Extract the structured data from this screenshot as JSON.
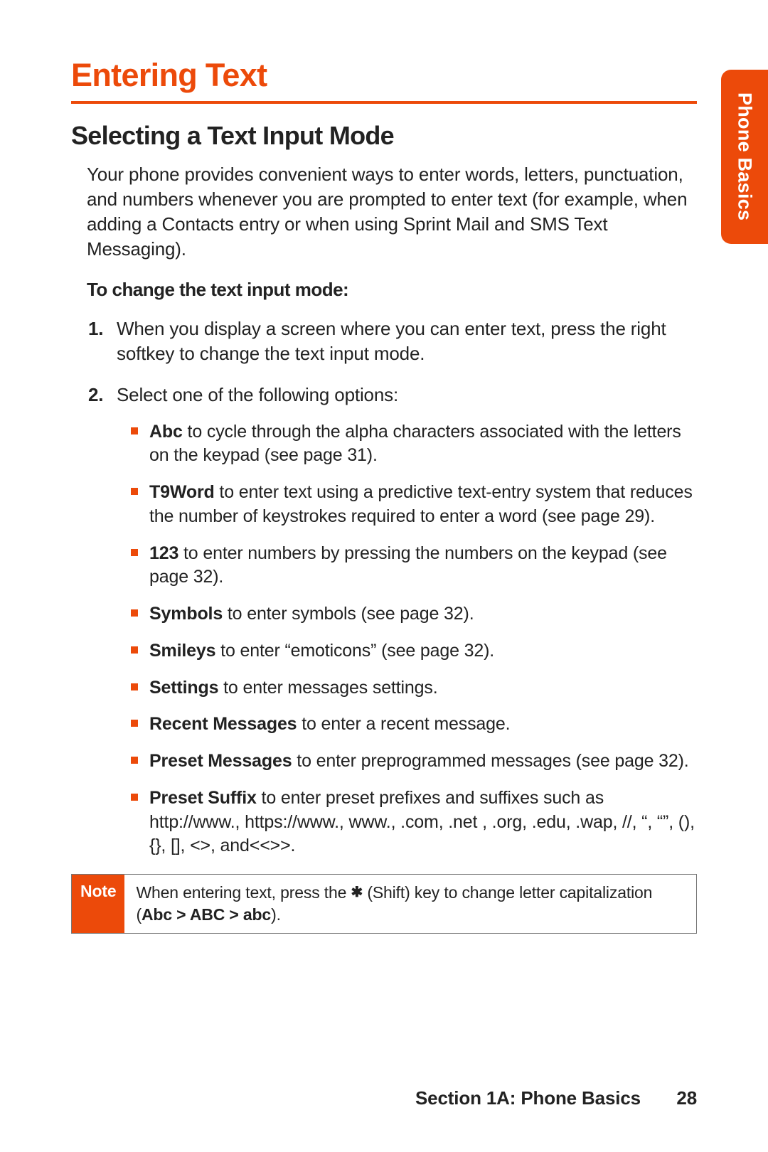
{
  "side_tab": "Phone Basics",
  "title": "Entering Text",
  "subtitle": "Selecting a Text Input Mode",
  "intro": "Your phone provides convenient ways to enter words, letters, punctuation, and numbers whenever you are prompted to enter text (for example, when adding a Contacts entry or when using Sprint Mail and SMS Text Messaging).",
  "subheading": "To change the text input mode:",
  "steps": [
    {
      "num": "1.",
      "text": "When you display a screen where you can enter text, press the right softkey to change the text input mode."
    },
    {
      "num": "2.",
      "text": "Select one of the following options:"
    }
  ],
  "options": [
    {
      "lead": "Abc",
      "rest": " to cycle through the alpha characters associated with the letters on the keypad (see page 31)."
    },
    {
      "lead": "T9Word",
      "rest": " to enter text using a predictive text-entry system that reduces the number of keystrokes required to enter a word (see page 29)."
    },
    {
      "lead": "123",
      "rest": " to enter numbers by pressing the numbers on the keypad (see page 32)."
    },
    {
      "lead": "Symbols",
      "rest": " to enter symbols (see page 32)."
    },
    {
      "lead": "Smileys",
      "rest": " to enter “emoticons” (see page 32)."
    },
    {
      "lead": "Settings",
      "rest": " to enter messages settings."
    },
    {
      "lead": "Recent Messages",
      "rest": "  to enter a recent message."
    },
    {
      "lead": "Preset Messages",
      "rest": " to enter preprogrammed messages (see page 32)."
    },
    {
      "lead": "Preset Suffix",
      "rest": " to enter preset prefixes and suffixes such as http://www., https://www., www., .com, .net , .org, .edu, .wap, //, “, “”, (), {}, [], <>, and<<>>."
    }
  ],
  "note": {
    "label": "Note",
    "pre": "When entering text, press the ",
    "star": "✱",
    "mid": " (Shift) key to change letter capitalization (",
    "bold": "Abc > ABC > abc",
    "post": ")."
  },
  "footer": {
    "section": "Section 1A: Phone Basics",
    "page": "28"
  }
}
